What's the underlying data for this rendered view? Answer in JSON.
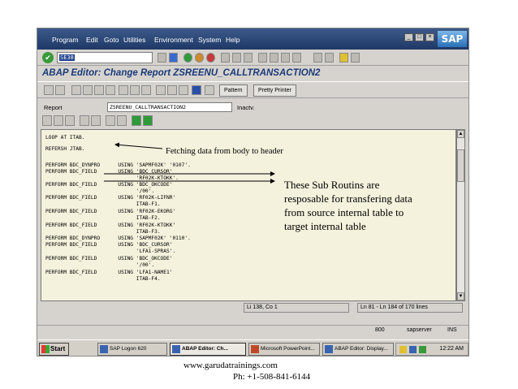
{
  "menu": [
    "Program",
    "Edit",
    "Goto",
    "Utilities",
    "Environment",
    "System",
    "Help"
  ],
  "brand": "SAP",
  "command_field_value": "SE38",
  "title": "ABAP Editor: Change Report ZSREENU_CALLTRANSACTION2",
  "app_toolbar": {
    "pattern": "Pattern",
    "pretty_printer": "Pretty Printer"
  },
  "report": {
    "label": "Report",
    "value": "ZSREENU_CALLTRANSACTION2",
    "status": "Inactv."
  },
  "code_lines": [
    "LOOP AT ITAB.",
    "REFERSH JTAB.",
    "PERFORM BDC_DYNPRO      USING 'SAPMF02K' '0107'.",
    "PERFORM BDC_FIELD       USING 'BDC_CURSOR'",
    "                              'RF02K-KTOKK'.",
    "PERFORM BDC_FIELD       USING 'BDC_OKCODE'",
    "                              '/00'.",
    "PERFORM BDC_FIELD       USING 'RF02K-LIFNR'",
    "                              ITAB-F1.",
    "PERFORM BDC_FIELD       USING 'RF02K-EKORG'",
    "                              ITAB-F2.",
    "PERFORM BDC_FIELD       USING 'RF02K-KTOKK'",
    "                              ITAB-F3.",
    "PERFORM BDC_DYNPRO      USING 'SAPMF02K' '0110'.",
    "PERFORM BDC_FIELD       USING 'BDC_CURSOR'",
    "                              'LFA1-SPRAS'.",
    "PERFORM BDC_FIELD       USING 'BDC_OKCODE'",
    "                              '/00'.",
    "PERFORM BDC_FIELD       USING 'LFA1-NAME1'",
    "                              ITAB-F4."
  ],
  "editor_status": {
    "cursor": "Li 138, Co 1",
    "lines": "Ln 81 - Ln 184 of 170 lines"
  },
  "sap_status": {
    "client": "800",
    "server": "sapserver",
    "mode": "INS"
  },
  "taskbar": {
    "start": "Start",
    "items": [
      "SAP Logon 620",
      "ABAP Editor: Ch...",
      "Microsoft PowerPoint...",
      "ABAP Editor: Display..."
    ],
    "clock": "12:22 AM"
  },
  "annotations": {
    "fetch": "Fetching data from body to header",
    "subroutines": "These Sub Routins are resposable for transfering data from source internal table to target internal table"
  },
  "footer": {
    "website": "www.garudatrainings.com",
    "phone": "Ph: +1-508-841-6144"
  }
}
